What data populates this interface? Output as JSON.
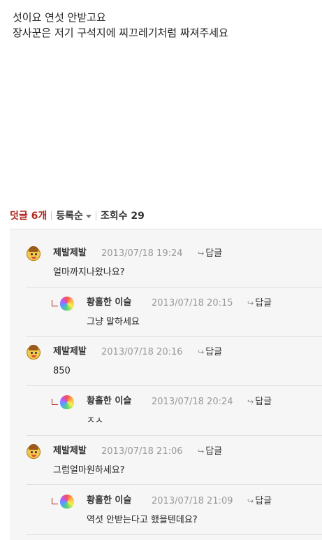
{
  "post": {
    "lines": [
      "섯이요 연섯 안받고요",
      "장사꾼은 저기 구석지에 찌끄레기처럼 짜져주세요"
    ]
  },
  "comment_bar": {
    "count_label": "덧글 6개",
    "sort_label": "등록순",
    "views_label": "조회수 29"
  },
  "comments": [
    {
      "author": "제발제발",
      "date": "2013/07/18 19:24",
      "reply_label": "답글",
      "text": "얼마까지나왔나요?",
      "avatar_icon": "cartoon-face-icon"
    },
    {
      "author": "황홀한 이슬",
      "date": "2013/07/18 20:15",
      "reply_label": "답글",
      "text": "그냥 말하세요",
      "avatar_icon": "rainbow-heart-icon",
      "is_reply": true
    },
    {
      "author": "제발제발",
      "date": "2013/07/18 20:16",
      "reply_label": "답글",
      "text": "850",
      "avatar_icon": "cartoon-face-icon"
    },
    {
      "author": "황홀한 이슬",
      "date": "2013/07/18 20:24",
      "reply_label": "답글",
      "text": "ㅈㅅ",
      "avatar_icon": "rainbow-heart-icon",
      "is_reply": true
    },
    {
      "author": "제발제발",
      "date": "2013/07/18 21:06",
      "reply_label": "답글",
      "text": "그럼얼마원하세요?",
      "avatar_icon": "cartoon-face-icon"
    },
    {
      "author": "황홀한 이슬",
      "date": "2013/07/18 21:09",
      "reply_label": "답글",
      "text": "역섯 안받는다고 했을텐데요?",
      "avatar_icon": "rainbow-heart-icon",
      "is_reply": true
    }
  ],
  "colors": {
    "accent": "#b0281e",
    "box_bg": "#f6f6f6",
    "date": "#999999"
  }
}
